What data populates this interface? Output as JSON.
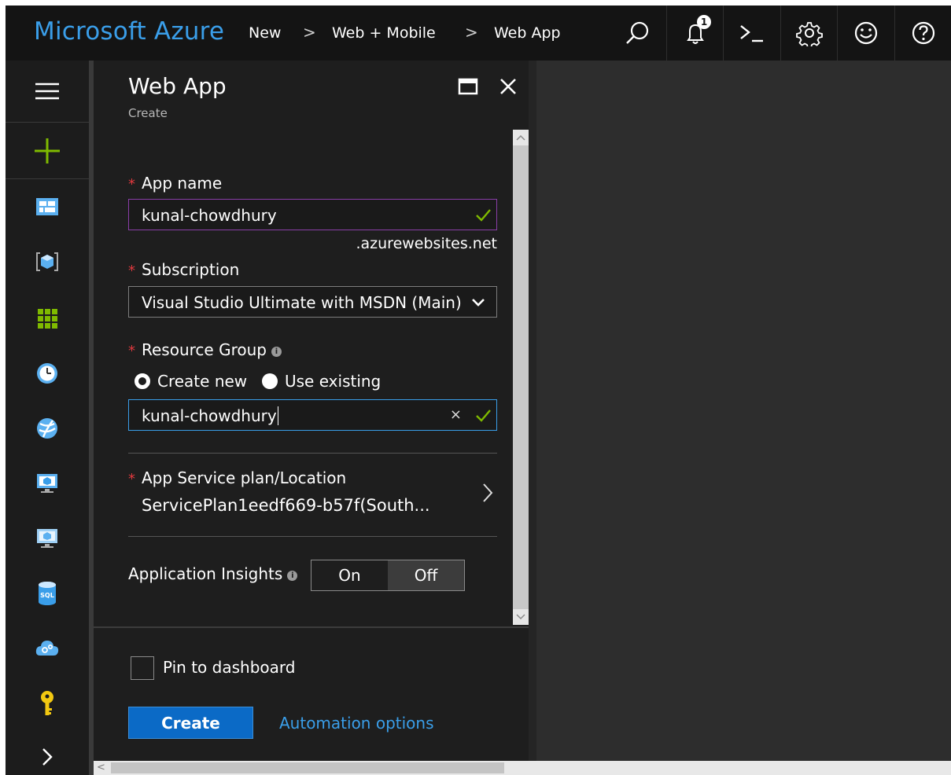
{
  "topbar": {
    "brand": "Microsoft Azure",
    "breadcrumbs": [
      "New",
      "Web + Mobile",
      "Web App"
    ],
    "separator": ">",
    "notification_count": "1",
    "icons": [
      "search-icon",
      "notifications-icon",
      "cloud-shell-icon",
      "settings-icon",
      "feedback-icon",
      "help-icon"
    ]
  },
  "leftnav": {
    "icons": [
      "hamburger-icon",
      "new-plus-icon",
      "dashboard-icon",
      "resource-groups-icon",
      "all-resources-icon",
      "recent-icon",
      "app-services-icon",
      "virtual-machines-icon",
      "virtual-machines-classic-icon",
      "sql-databases-icon",
      "cloud-services-icon",
      "key-vault-icon",
      "more-services-icon"
    ]
  },
  "blade": {
    "title": "Web App",
    "subtitle": "Create",
    "app_name": {
      "label": "App name",
      "value": "kunal-chowdhury",
      "suffix": ".azurewebsites.net"
    },
    "subscription": {
      "label": "Subscription",
      "value": "Visual Studio Ultimate with MSDN (Main)"
    },
    "resource_group": {
      "label": "Resource Group",
      "options": [
        "Create new",
        "Use existing"
      ],
      "selected": "Create new",
      "value": "kunal-chowdhury",
      "clear": "×"
    },
    "service_plan": {
      "label": "App Service plan/Location",
      "value": "ServicePlan1eedf669-b57f(South..."
    },
    "insights": {
      "label": "Application Insights",
      "options": [
        "On",
        "Off"
      ],
      "selected": "Off"
    },
    "pin_label": "Pin to dashboard",
    "create_label": "Create",
    "automation_label": "Automation options"
  },
  "colors": {
    "accent": "#3a9ee9",
    "primary_button": "#0b6ac6",
    "required": "#e0393e",
    "valid": "#7fba00",
    "focus_purple": "#8a3ea8",
    "focus_blue": "#3a9ee9"
  }
}
